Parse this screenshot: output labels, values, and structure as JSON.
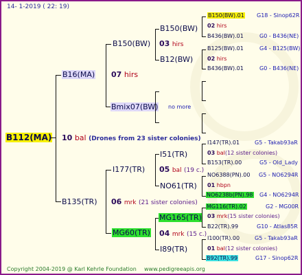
{
  "header": {
    "date": "14-  1-2019 (  22: 19)"
  },
  "root": {
    "name": "B112(MA)",
    "num": "10",
    "breeder": "bal",
    "note": "(Drones from 23 sister colonies)"
  },
  "sire_side": {
    "name": "B16(MA)",
    "num": "07",
    "breeder": "hirs",
    "b150": {
      "name": "B150(BW)",
      "num": "03",
      "breeder": "hirs",
      "top": {
        "name": "B150(BW)",
        "num": "02",
        "breeder": "hirs",
        "line1": "B150(BW).01",
        "ref1": "G18 - Sinop62R",
        "line2": "B436(BW).01",
        "ref2": "G0 - B436(NE)"
      },
      "b12": {
        "name": "B12(BW)",
        "num": "02",
        "breeder": "hirs",
        "line1": "B125(BW).01",
        "ref1": "G4 - B125(BW)",
        "line2": "B436(BW).01",
        "ref2": "G0 - B436(NE)"
      }
    },
    "bmix": {
      "name": "Bmix07(BW)",
      "more": "no more"
    }
  },
  "dam_side": {
    "name": "B135(TR)",
    "num": "06",
    "breeder": "mrk",
    "note": "(21 sister colonies)",
    "i177": {
      "name": "I177(TR)",
      "num": "05",
      "breeder": "bal",
      "note": "(19 c.)",
      "i51": {
        "name": "I51(TR)",
        "num": "03",
        "breeder": "bal",
        "note": "(12 sister colonies)",
        "line1": "I147(TR).01",
        "ref1": "G5 - Takab93aR",
        "line2": "B153(TR).00",
        "ref2": "G5 - Old_Lady"
      },
      "no61": {
        "name": "NO61(TR)",
        "num": "01",
        "breeder": "hbpn",
        "line1": "NO6388(PN).00",
        "ref1": "G5 - NO6294R",
        "line2": "NO6238b(PN).98",
        "ref2": "G4 - NO6294R"
      }
    },
    "mg60": {
      "name": "MG60(TR)",
      "num": "04",
      "breeder": "mrk",
      "note": "(15 c.)",
      "mg165": {
        "name": "MG165(TR)",
        "num": "03",
        "breeder": "mrk",
        "note": "(15 sister colonies)",
        "line1": "MG116(TR).02",
        "ref1": "G2 - MG00R",
        "line2": "B22(TR).99",
        "ref2": "G10 - Atlas85R"
      },
      "i89": {
        "name": "I89(TR)",
        "num": "01",
        "breeder": "bal",
        "note": "(12 sister colonies)",
        "line1": "I100(TR).00",
        "ref1": "G5 - Takab93aR",
        "line2": "B92(TR).99",
        "ref2": "G17 - Sinop62R"
      }
    }
  },
  "footer": {
    "copyright": "Copyright 2004-2019 @ Karl Kehrle Foundation",
    "site": "www.pedigreeapis.org"
  }
}
